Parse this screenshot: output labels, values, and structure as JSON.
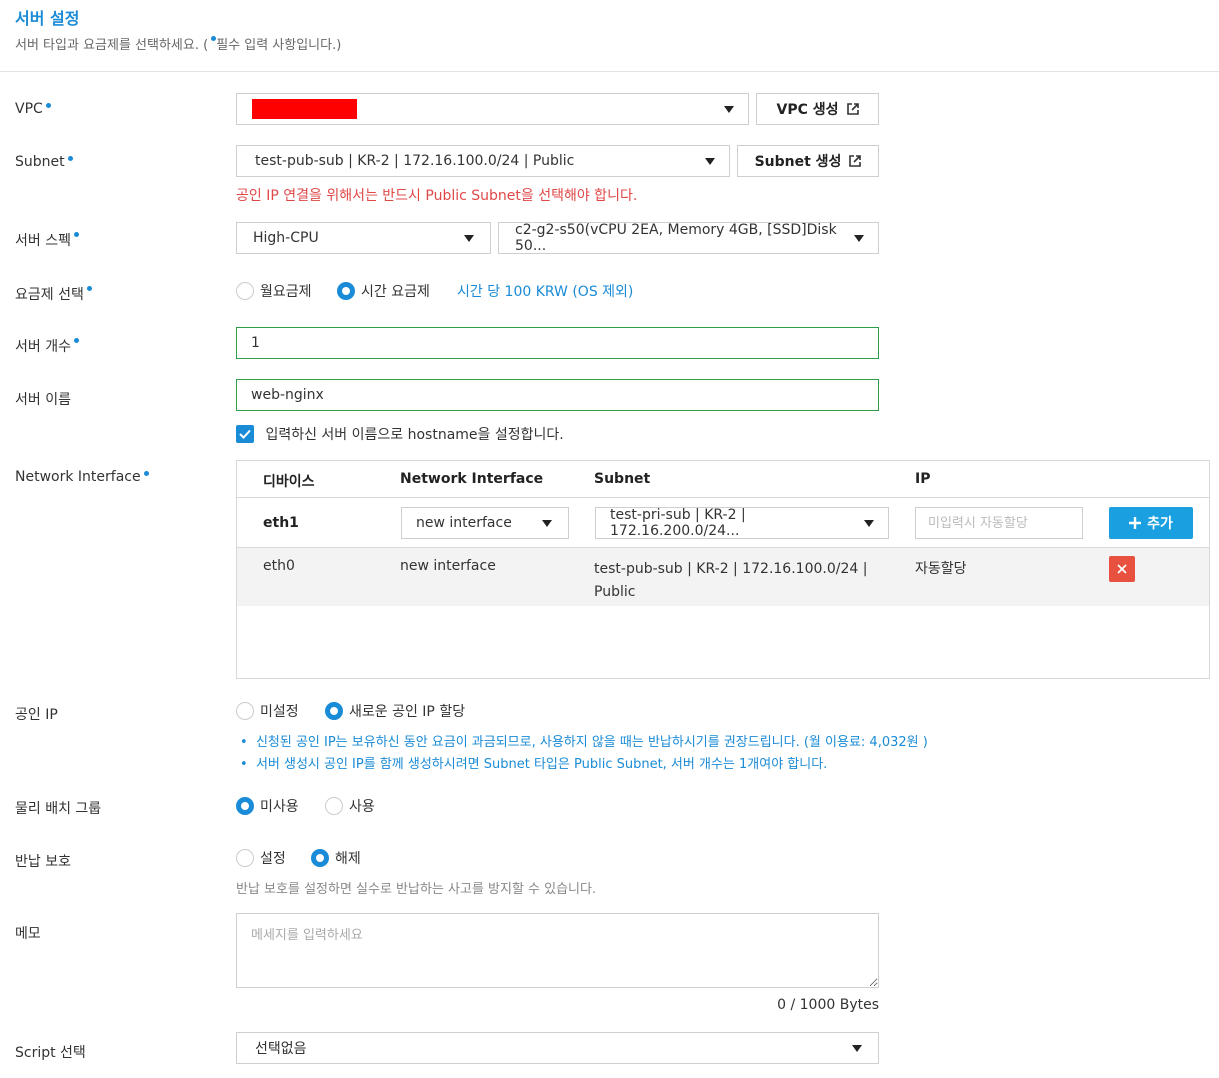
{
  "header": {
    "title": "서버 설정",
    "subtitle_prefix": "서버 타입과 요금제를 선택하세요. (",
    "subtitle_suffix": "필수 입력 사항입니다.)"
  },
  "colors": {
    "accent": "#1a8bd6",
    "error": "#e04848",
    "redacted": "#ff0000",
    "add": "#1aa0e0",
    "delete": "#e8513f"
  },
  "vpc": {
    "label": "VPC",
    "value": "",
    "create_button": "VPC 생성"
  },
  "subnet": {
    "label": "Subnet",
    "value": "test-pub-sub | KR-2 | 172.16.100.0/24 | Public",
    "create_button": "Subnet 생성",
    "warning": "공인 IP 연결을 위해서는 반드시 Public Subnet을 선택해야 합니다."
  },
  "server_spec": {
    "label": "서버 스펙",
    "type": "High-CPU",
    "spec": "c2-g2-s50(vCPU 2EA, Memory 4GB, [SSD]Disk 50..."
  },
  "billing": {
    "label": "요금제 선택",
    "monthly": "월요금제",
    "hourly": "시간 요금제",
    "selected": "hourly",
    "price_note": "시간 당 100 KRW (OS 제외)"
  },
  "server_count": {
    "label": "서버 개수",
    "value": "1"
  },
  "server_name": {
    "label": "서버 이름",
    "value": "web-nginx",
    "hostname_check_label": "입력하신 서버 이름으로 hostname을 설정합니다.",
    "hostname_checked": true
  },
  "network_interface": {
    "label": "Network Interface",
    "columns": [
      "디바이스",
      "Network Interface",
      "Subnet",
      "IP"
    ],
    "new_row": {
      "device": "eth1",
      "interface": "new interface",
      "subnet": "test-pri-sub | KR-2 | 172.16.200.0/24...",
      "ip_placeholder": "미입력시 자동할당",
      "add_button": "추가"
    },
    "rows": [
      {
        "device": "eth0",
        "interface": "new interface",
        "subnet_line1": "test-pub-sub | KR-2 | 172.16.100.0/24 |",
        "subnet_line2": "Public",
        "ip": "자동할당"
      }
    ]
  },
  "public_ip": {
    "label": "공인 IP",
    "option_none": "미설정",
    "option_new": "새로운 공인 IP 할당",
    "selected": "new",
    "notes": [
      "신청된 공인 IP는 보유하신 동안 요금이 과금되므로, 사용하지 않을 때는 반납하시기를 권장드립니다. (월 이용료: 4,032원 )",
      "서버 생성시 공인 IP를 함께 생성하시려면 Subnet 타입은 Public Subnet, 서버 개수는 1개여야 합니다."
    ]
  },
  "placement_group": {
    "label": "물리 배치 그룹",
    "option_unused": "미사용",
    "option_used": "사용",
    "selected": "unused"
  },
  "return_protection": {
    "label": "반납 보호",
    "option_on": "설정",
    "option_off": "해제",
    "selected": "off",
    "help": "반납 보호를 설정하면 실수로 반납하는 사고를 방지할 수 있습니다."
  },
  "memo": {
    "label": "메모",
    "placeholder": "메세지를 입력하세요",
    "counter": "0 / 1000 Bytes"
  },
  "script": {
    "label": "Script 선택",
    "value": "선택없음"
  }
}
